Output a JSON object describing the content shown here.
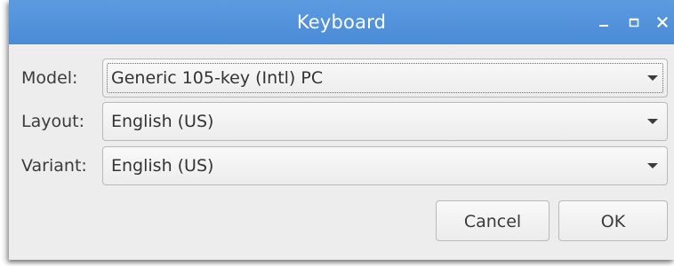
{
  "window": {
    "title": "Keyboard",
    "controls": {
      "minimize_icon": "minimize-icon",
      "maximize_icon": "maximize-icon",
      "close_icon": "close-icon"
    },
    "accent_color": "#4a8bd7"
  },
  "form": {
    "model": {
      "label": "Model:",
      "value": "Generic 105-key (Intl) PC",
      "focused": true
    },
    "layout": {
      "label": "Layout:",
      "value": "English (US)"
    },
    "variant": {
      "label": "Variant:",
      "value": "English (US)"
    }
  },
  "buttons": {
    "cancel": "Cancel",
    "ok": "OK"
  }
}
